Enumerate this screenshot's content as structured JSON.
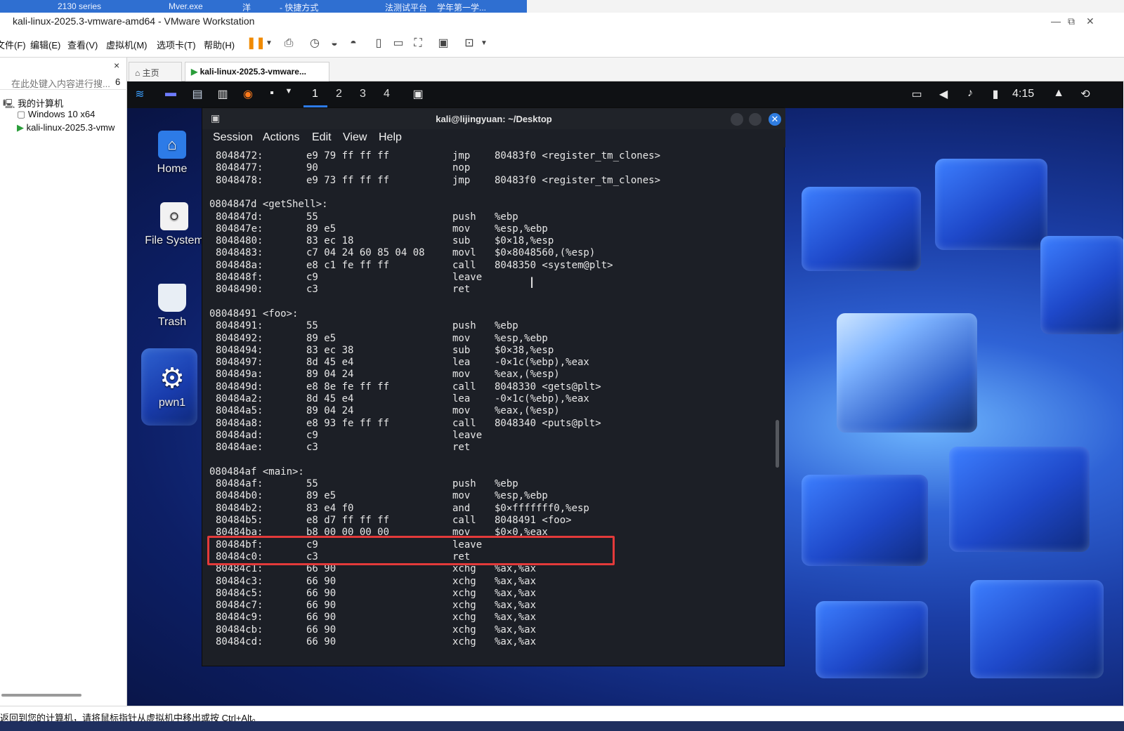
{
  "host": {
    "top_strip": [
      "2130 series",
      "Mver.exe",
      "洋",
      "- 快捷方式",
      "法测试平台",
      "学年第一学..."
    ],
    "window_title": "kali-linux-2025.3-vmware-amd64 - VMware Workstation",
    "controls": {
      "minimize": "—",
      "restore": "⧉",
      "close": "✕"
    }
  },
  "menu": {
    "items": [
      "文件(F)",
      "编辑(E)",
      "查看(V)",
      "虚拟机(M)",
      "选项卡(T)",
      "帮助(H)"
    ]
  },
  "library": {
    "search_placeholder": "在此处键入内容进行搜...",
    "search_count": "6",
    "close": "×",
    "root": "我的计算机",
    "vms": [
      "Windows 10 x64",
      "kali-linux-2025.3-vmw"
    ]
  },
  "tabs": [
    {
      "label": "主页"
    },
    {
      "label": "kali-linux-2025.3-vmware..."
    }
  ],
  "guest": {
    "workspaces": [
      "1",
      "2",
      "3",
      "4"
    ],
    "clock": "4:15",
    "desktop_icons": [
      {
        "label": "Home",
        "color": "#2d7be7"
      },
      {
        "label": "File System",
        "color": "#f2f2f2"
      },
      {
        "label": "Trash",
        "color": "#e8eef5"
      },
      {
        "label": "pwn1",
        "color": "#ffffff"
      }
    ]
  },
  "terminal": {
    "title": "kali@lijingyuan: ~/Desktop",
    "menu": [
      "Session",
      "Actions",
      "Edit",
      "View",
      "Help"
    ],
    "highlight_color": "#e33a3a",
    "lines": [
      {
        "addr": "8048472:",
        "bytes": "e9 79 ff ff ff",
        "op": "jmp",
        "args": "80483f0 <register_tm_clones>"
      },
      {
        "addr": "8048477:",
        "bytes": "90",
        "op": "nop",
        "args": ""
      },
      {
        "addr": "8048478:",
        "bytes": "e9 73 ff ff ff",
        "op": "jmp",
        "args": "80483f0 <register_tm_clones>"
      },
      {
        "addr": "",
        "bytes": "",
        "op": "",
        "args": ""
      },
      {
        "label": "0804847d <getShell>:"
      },
      {
        "addr": "804847d:",
        "bytes": "55",
        "op": "push",
        "args": "%ebp"
      },
      {
        "addr": "804847e:",
        "bytes": "89 e5",
        "op": "mov",
        "args": "%esp,%ebp"
      },
      {
        "addr": "8048480:",
        "bytes": "83 ec 18",
        "op": "sub",
        "args": "$0×18,%esp"
      },
      {
        "addr": "8048483:",
        "bytes": "c7 04 24 60 85 04 08",
        "op": "movl",
        "args": "$0×8048560,(%esp)"
      },
      {
        "addr": "804848a:",
        "bytes": "e8 c1 fe ff ff",
        "op": "call",
        "args": "8048350 <system@plt>"
      },
      {
        "addr": "804848f:",
        "bytes": "c9",
        "op": "leave",
        "args": ""
      },
      {
        "addr": "8048490:",
        "bytes": "c3",
        "op": "ret",
        "args": ""
      },
      {
        "addr": "",
        "bytes": "",
        "op": "",
        "args": ""
      },
      {
        "label": "08048491 <foo>:"
      },
      {
        "addr": "8048491:",
        "bytes": "55",
        "op": "push",
        "args": "%ebp"
      },
      {
        "addr": "8048492:",
        "bytes": "89 e5",
        "op": "mov",
        "args": "%esp,%ebp"
      },
      {
        "addr": "8048494:",
        "bytes": "83 ec 38",
        "op": "sub",
        "args": "$0×38,%esp"
      },
      {
        "addr": "8048497:",
        "bytes": "8d 45 e4",
        "op": "lea",
        "args": "-0×1c(%ebp),%eax"
      },
      {
        "addr": "804849a:",
        "bytes": "89 04 24",
        "op": "mov",
        "args": "%eax,(%esp)"
      },
      {
        "addr": "804849d:",
        "bytes": "e8 8e fe ff ff",
        "op": "call",
        "args": "8048330 <gets@plt>"
      },
      {
        "addr": "80484a2:",
        "bytes": "8d 45 e4",
        "op": "lea",
        "args": "-0×1c(%ebp),%eax"
      },
      {
        "addr": "80484a5:",
        "bytes": "89 04 24",
        "op": "mov",
        "args": "%eax,(%esp)"
      },
      {
        "addr": "80484a8:",
        "bytes": "e8 93 fe ff ff",
        "op": "call",
        "args": "8048340 <puts@plt>"
      },
      {
        "addr": "80484ad:",
        "bytes": "c9",
        "op": "leave",
        "args": ""
      },
      {
        "addr": "80484ae:",
        "bytes": "c3",
        "op": "ret",
        "args": ""
      },
      {
        "addr": "",
        "bytes": "",
        "op": "",
        "args": ""
      },
      {
        "label": "080484af <main>:"
      },
      {
        "addr": "80484af:",
        "bytes": "55",
        "op": "push",
        "args": "%ebp"
      },
      {
        "addr": "80484b0:",
        "bytes": "89 e5",
        "op": "mov",
        "args": "%esp,%ebp"
      },
      {
        "addr": "80484b2:",
        "bytes": "83 e4 f0",
        "op": "and",
        "args": "$0×fffffff0,%esp"
      },
      {
        "addr": "80484b5:",
        "bytes": "e8 d7 ff ff ff",
        "op": "call",
        "args": "8048491 <foo>"
      },
      {
        "addr": "80484ba:",
        "bytes": "b8 00 00 00 00",
        "op": "mov",
        "args": "$0×0,%eax"
      },
      {
        "addr": "80484bf:",
        "bytes": "c9",
        "op": "leave",
        "args": ""
      },
      {
        "addr": "80484c0:",
        "bytes": "c3",
        "op": "ret",
        "args": ""
      },
      {
        "addr": "80484c1:",
        "bytes": "66 90",
        "op": "xchg",
        "args": "%ax,%ax"
      },
      {
        "addr": "80484c3:",
        "bytes": "66 90",
        "op": "xchg",
        "args": "%ax,%ax"
      },
      {
        "addr": "80484c5:",
        "bytes": "66 90",
        "op": "xchg",
        "args": "%ax,%ax"
      },
      {
        "addr": "80484c7:",
        "bytes": "66 90",
        "op": "xchg",
        "args": "%ax,%ax"
      },
      {
        "addr": "80484c9:",
        "bytes": "66 90",
        "op": "xchg",
        "args": "%ax,%ax"
      },
      {
        "addr": "80484cb:",
        "bytes": "66 90",
        "op": "xchg",
        "args": "%ax,%ax"
      },
      {
        "addr": "80484cd:",
        "bytes": "66 90",
        "op": "xchg",
        "args": "%ax,%ax"
      }
    ]
  },
  "status": {
    "text": "返回到您的计算机，请将鼠标指针从虚拟机中移出或按 Ctrl+Alt。"
  }
}
